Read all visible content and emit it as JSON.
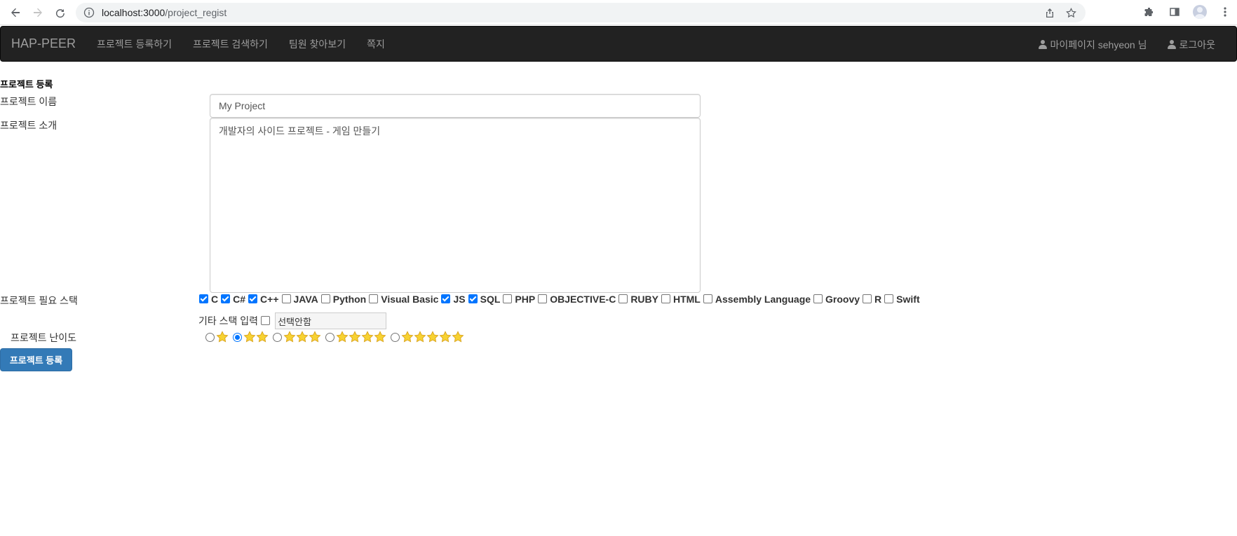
{
  "browser": {
    "url_host": "localhost:3000",
    "url_path": "/project_regist"
  },
  "navbar": {
    "brand": "HAP-PEER",
    "items": [
      {
        "label": "프로젝트 등록하기"
      },
      {
        "label": "프로젝트 검색하기"
      },
      {
        "label": "팀원 찾아보기"
      },
      {
        "label": "쪽지"
      }
    ],
    "mypage": "마이페이지 sehyeon 님",
    "logout": "로그아웃"
  },
  "form": {
    "heading": "프로젝트 등록",
    "name_label": "프로젝트 이름",
    "name_value": "My Project",
    "intro_label": "프로젝트 소개",
    "intro_value": "개발자의 사이드 프로젝트 - 게임 만들기",
    "stack_label": "프로젝트 필요 스택",
    "stacks": [
      {
        "label": "C",
        "checked": true
      },
      {
        "label": "C#",
        "checked": true
      },
      {
        "label": "C++",
        "checked": true
      },
      {
        "label": "JAVA",
        "checked": false
      },
      {
        "label": "Python",
        "checked": false
      },
      {
        "label": "Visual Basic",
        "checked": false
      },
      {
        "label": "JS",
        "checked": true
      },
      {
        "label": "SQL",
        "checked": true
      },
      {
        "label": "PHP",
        "checked": false
      },
      {
        "label": "OBJECTIVE-C",
        "checked": false
      },
      {
        "label": "RUBY",
        "checked": false
      },
      {
        "label": "HTML",
        "checked": false
      },
      {
        "label": "Assembly Language",
        "checked": false
      },
      {
        "label": "Groovy",
        "checked": false
      },
      {
        "label": "R",
        "checked": false
      },
      {
        "label": "Swift",
        "checked": false
      }
    ],
    "other_stack_label": "기타 스택 입력",
    "other_stack_checked": false,
    "other_stack_value": "선택안함",
    "difficulty_label": "프로젝트 난이도",
    "difficulty_options": [
      {
        "stars": 1,
        "selected": false
      },
      {
        "stars": 2,
        "selected": true
      },
      {
        "stars": 3,
        "selected": false
      },
      {
        "stars": 4,
        "selected": false
      },
      {
        "stars": 5,
        "selected": false
      }
    ],
    "submit_label": "프로젝트 등록"
  },
  "colors": {
    "navbar_bg": "#222222",
    "primary_button": "#337ab7",
    "checkbox_accent": "#0075ff",
    "star_fill": "#f7d232"
  }
}
